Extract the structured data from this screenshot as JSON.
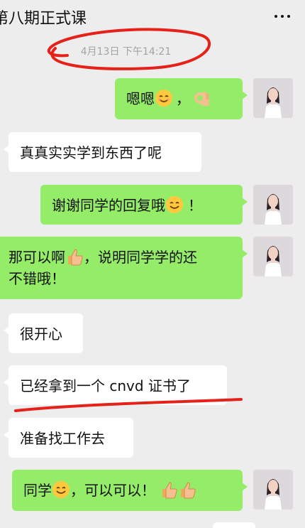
{
  "header": {
    "title": "第八期正式课",
    "more_icon": "more-dots-icon"
  },
  "timestamp": "4月13日 下午14:21",
  "messages": [
    {
      "side": "self",
      "text": "嗯嗯",
      "trailing": "，",
      "emojis": [
        "smile-emoji",
        "ok-hand-emoji"
      ]
    },
    {
      "side": "other",
      "text": "真真实实学到东西了呢"
    },
    {
      "side": "self",
      "text": "谢谢同学的回复哦",
      "trailing": "！",
      "emojis": [
        "smile-emoji"
      ]
    },
    {
      "side": "self",
      "text_line1_pre": "那可以啊",
      "text_line1_post": "，说明同学学的还",
      "text_line2": "不错哦！",
      "emojis": [
        "thumbs-up-emoji"
      ]
    },
    {
      "side": "other",
      "text": "很开心"
    },
    {
      "side": "other",
      "text": "已经拿到一个 cnvd 证书了"
    },
    {
      "side": "other",
      "text": "准备找工作去"
    },
    {
      "side": "self",
      "text_pre": "同学",
      "text_post": "，可以可以！",
      "emojis": [
        "smile-emoji",
        "thumbs-up-emoji",
        "thumbs-up-emoji"
      ]
    }
  ],
  "colors": {
    "self_bubble": "#95ec69",
    "other_bubble": "#ffffff",
    "background": "#ededed",
    "annotation": "#e5221a"
  }
}
